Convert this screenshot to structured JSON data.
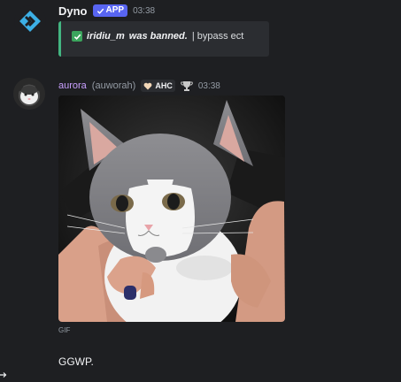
{
  "messages": {
    "dyno": {
      "author": "Dyno",
      "badge": "APP",
      "timestamp": "03:38",
      "embed": {
        "banned_user": "iridiu_m",
        "action_text": "was banned.",
        "reason": "| bypass ect"
      },
      "avatar_icon": "dyno-diamond-icon",
      "accent_color": "#43b581"
    },
    "aurora": {
      "display_name": "aurora",
      "username": "(auworah)",
      "role_tag": "AHC",
      "timestamp": "03:38",
      "attachment_type": "GIF",
      "content": "GGWP.",
      "name_color": "#c9a0ff"
    }
  },
  "colors": {
    "background": "#1e1f22",
    "embed_bg": "#2b2d31",
    "app_badge": "#5865f2"
  }
}
